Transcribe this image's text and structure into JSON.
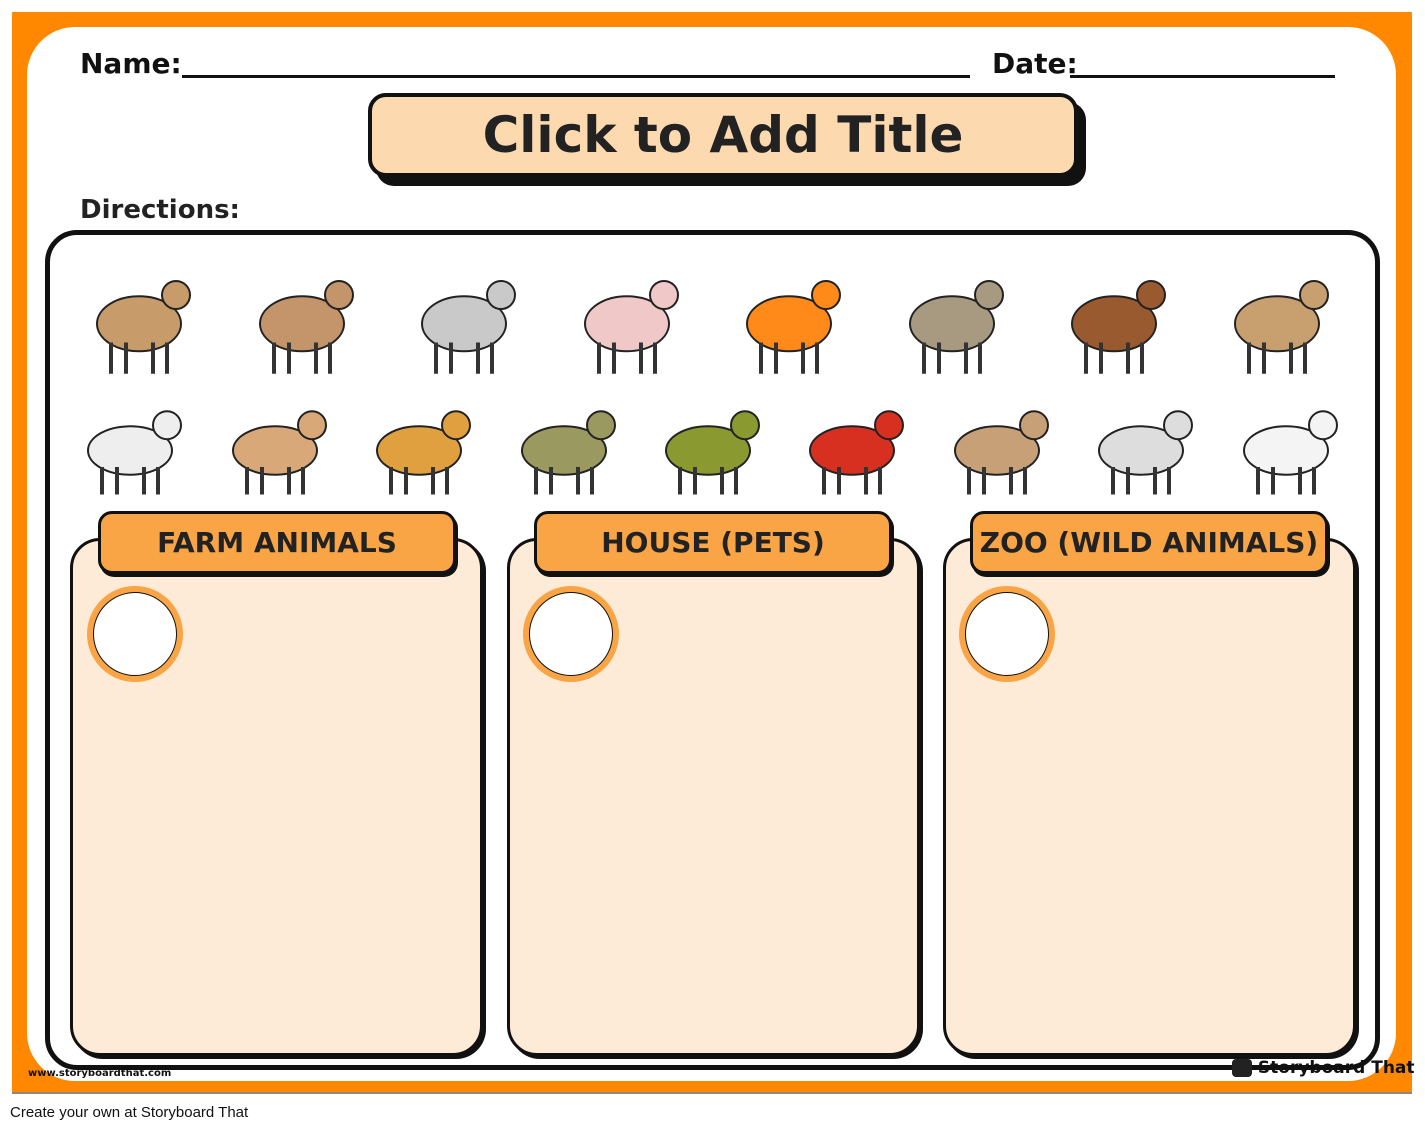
{
  "header": {
    "name_label": "Name:",
    "date_label": "Date:",
    "title": "Click to Add Title",
    "directions_label": "Directions:"
  },
  "animals_row1": [
    {
      "icon": "dog-icon",
      "color": "#C89B6A"
    },
    {
      "icon": "goat-icon",
      "color": "#C4956A"
    },
    {
      "icon": "elephant-icon",
      "color": "#C9C9C9"
    },
    {
      "icon": "pig-icon",
      "color": "#F0C8C8"
    },
    {
      "icon": "goldfish-icon",
      "color": "#FF8A1A"
    },
    {
      "icon": "duck-icon",
      "color": "#A89A80"
    },
    {
      "icon": "horse-icon",
      "color": "#9A5A30"
    },
    {
      "icon": "lion-icon",
      "color": "#C8A070"
    }
  ],
  "animals_row2": [
    {
      "icon": "cow-icon",
      "color": "#EEEEEE"
    },
    {
      "icon": "cat-icon",
      "color": "#D9A878"
    },
    {
      "icon": "leopard-icon",
      "color": "#E0A040"
    },
    {
      "icon": "snake-icon",
      "color": "#9A9A60"
    },
    {
      "icon": "bird-icon",
      "color": "#8A9A30"
    },
    {
      "icon": "rooster-icon",
      "color": "#D83020"
    },
    {
      "icon": "kangaroo-icon",
      "color": "#C8A078"
    },
    {
      "icon": "zebra-icon",
      "color": "#DDDDDD"
    },
    {
      "icon": "lamb-icon",
      "color": "#F4F4F4"
    }
  ],
  "categories": [
    {
      "label": "FARM ANIMALS"
    },
    {
      "label": "HOUSE (PETS)"
    },
    {
      "label": "ZOO (WILD ANIMALS)"
    }
  ],
  "footer": {
    "website": "www.storyboardthat.com",
    "logo_text": "Storyboard That",
    "caption": "Create your own at Storyboard That"
  },
  "colors": {
    "frame": "#FF8800",
    "title_fill": "#FDD9B0",
    "header_fill": "#F9A545",
    "panel_fill": "#FEEBD7"
  }
}
